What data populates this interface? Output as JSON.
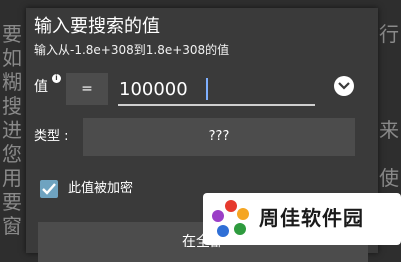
{
  "background": {
    "left_chars": [
      "要",
      "如",
      "糊",
      "搜",
      "进",
      "您",
      "用",
      "要",
      "窗"
    ],
    "right_chars": [
      "行",
      "",
      "",
      "",
      "来",
      "",
      "使",
      "",
      ""
    ]
  },
  "dialog": {
    "title": "输入要搜索的值",
    "subtitle": "输入从-1.8e+308到1.8e+308的值",
    "value_label": "值",
    "info_icon": "info-icon",
    "operator": "=",
    "value": "100000",
    "dropdown_icon": "chevron-down-icon",
    "type_label": "类型 :",
    "type_value": "???",
    "checkbox_checked": true,
    "checkbox_label": "此值被加密",
    "bottom_button": "在全部"
  },
  "watermark": {
    "text": "周佳软件园"
  },
  "colors": {
    "dialog_bg": "#3a3a3a",
    "control_bg": "#4c4c4c",
    "checkbox": "#6fa3c0"
  }
}
